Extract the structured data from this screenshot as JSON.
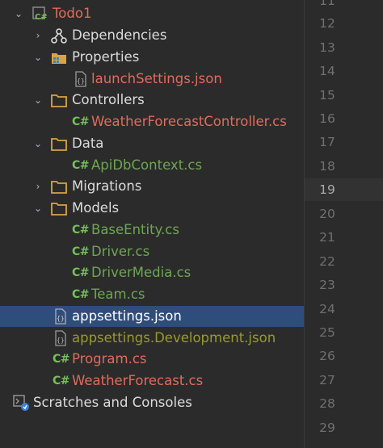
{
  "project": {
    "name": "Todo1"
  },
  "tree": {
    "dependencies": "Dependencies",
    "properties": {
      "label": "Properties",
      "launch": "launchSettings.json"
    },
    "controllers": {
      "label": "Controllers",
      "weather_controller": "WeatherForecastController.cs"
    },
    "data": {
      "label": "Data",
      "api_db_context": "ApiDbContext.cs"
    },
    "migrations": "Migrations",
    "models": {
      "label": "Models",
      "items": [
        "BaseEntity.cs",
        "Driver.cs",
        "DriverMedia.cs",
        "Team.cs"
      ]
    },
    "appsettings": "appsettings.json",
    "appsettings_dev": "appsettings.Development.json",
    "program": "Program.cs",
    "weather_forecast": "WeatherForecast.cs",
    "scratches": "Scratches and Consoles"
  },
  "cs_badge": "C#",
  "gutter": {
    "top_partial": "11",
    "lines": [
      "12",
      "13",
      "14",
      "15",
      "16",
      "17",
      "18",
      "19",
      "20",
      "21",
      "22",
      "23",
      "24",
      "25",
      "26",
      "27",
      "28",
      "29"
    ]
  },
  "colors": {
    "selection": "#2f4d7a",
    "cs_green": "#74c05a",
    "folder_orange": "#d9a444",
    "modified_red": "#e06c5a",
    "added_green": "#6ea653"
  }
}
